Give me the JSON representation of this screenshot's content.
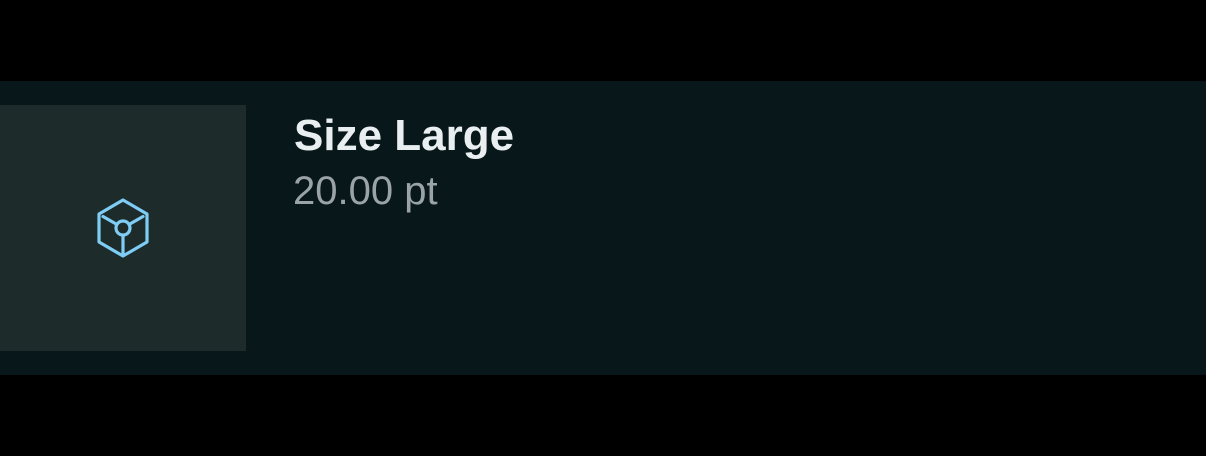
{
  "item": {
    "icon": "cube-icon",
    "title": "Size Large",
    "value": "20.00 pt"
  },
  "colors": {
    "background": "#000000",
    "band": "#08171a",
    "tile": "#1d2b2b",
    "icon": "#7fcdf5",
    "title": "#e9eef0",
    "value": "#9aa3a5"
  }
}
